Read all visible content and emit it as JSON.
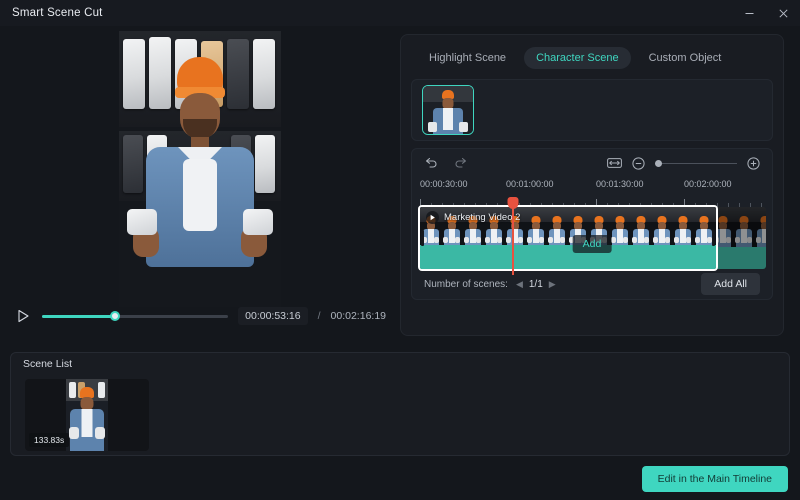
{
  "window": {
    "title": "Smart Scene Cut",
    "minimize_label": "Minimize",
    "close_label": "Close"
  },
  "preview": {
    "play_label": "Play",
    "current_time": "00:00:53:16",
    "separator": "/",
    "total_time": "00:02:16:19",
    "progress_percent": 39
  },
  "right_panel": {
    "tabs": [
      {
        "label": "Highlight Scene",
        "active": false
      },
      {
        "label": "Character Scene",
        "active": true
      },
      {
        "label": "Custom Object",
        "active": false
      }
    ],
    "character_thumb_name": "character-thumbnail",
    "timeline": {
      "undo_label": "Undo",
      "redo_label": "Redo",
      "fit_label": "Fit to screen",
      "zoom_out_label": "Zoom out",
      "zoom_in_label": "Zoom in",
      "zoom_value": 0,
      "ruler_labels": [
        "00:00:30:00",
        "00:01:00:00",
        "00:01:30:00",
        "00:02:00:00"
      ],
      "clip_title": "Marketing Video 2",
      "add_label": "Add",
      "playhead_time": "00:00:53:16"
    },
    "scene_count": {
      "label": "Number of scenes:",
      "prev_label": "Previous scene",
      "next_label": "Next scene",
      "value": "1/1"
    },
    "add_all_label": "Add All"
  },
  "scene_list": {
    "title": "Scene List",
    "items": [
      {
        "duration": "133.83s"
      }
    ]
  },
  "footer": {
    "primary_label": "Edit in the Main Timeline"
  },
  "colors": {
    "accent": "#3fd6c0",
    "playhead": "#e8523f",
    "panel_bg": "#191c22",
    "app_bg": "#14171c"
  }
}
